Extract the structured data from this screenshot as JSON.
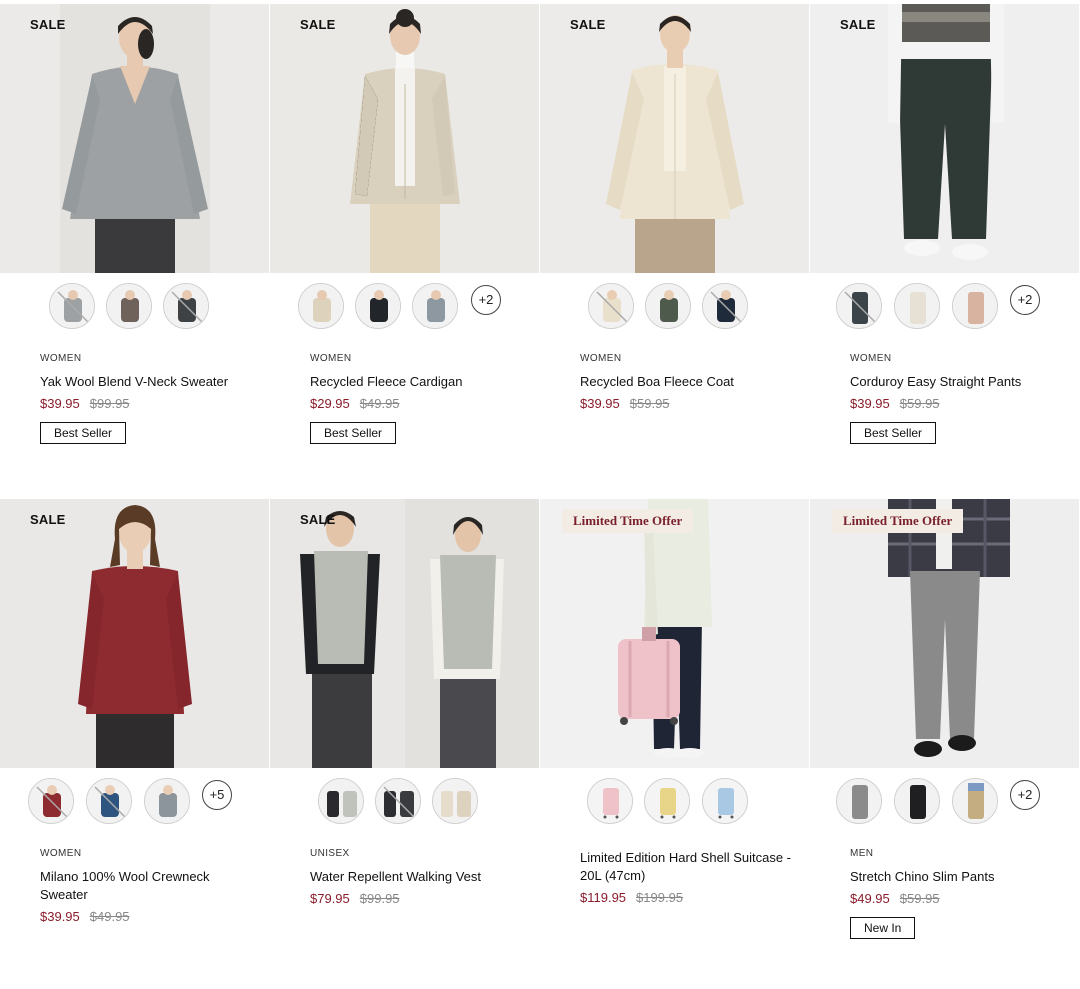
{
  "products": [
    {
      "tag": "SALE",
      "category": "WOMEN",
      "name": "Yak Wool Blend V-Neck Sweater",
      "price": "$39.95",
      "original_price": "$99.95",
      "badge": "Best Seller",
      "more_colors": "",
      "colors": {
        "bg": "#eceae8",
        "top": "#9da1a3",
        "bottom": "#3a3a3c",
        "skin": "#e6c9b0",
        "hair": "#2a2623"
      },
      "swatches": [
        "#9ea1a4",
        "#6e625a",
        "#3f4244"
      ]
    },
    {
      "tag": "SALE",
      "category": "WOMEN",
      "name": "Recycled Fleece Cardigan",
      "price": "$29.95",
      "original_price": "$49.95",
      "badge": "Best Seller",
      "more_colors": "+2",
      "colors": {
        "bg": "#ebe9e6",
        "top": "#d9d1bd",
        "bottom": "#e3d7c0",
        "skin": "#e6c9b0",
        "hair": "#2a2623"
      },
      "swatches": [
        "#ddd3bd",
        "#22252a",
        "#8e98a1"
      ]
    },
    {
      "tag": "SALE",
      "category": "WOMEN",
      "name": "Recycled Boa Fleece Coat",
      "price": "$39.95",
      "original_price": "$59.95",
      "badge": "",
      "more_colors": "",
      "colors": {
        "bg": "#ecebe9",
        "top": "#ede5d2",
        "bottom": "#b8a58c",
        "skin": "#e8cdb3",
        "hair": "#2c2420"
      },
      "swatches": [
        "#e9e0cc",
        "#4e5a4c",
        "#1f2a3a"
      ]
    },
    {
      "tag": "SALE",
      "category": "WOMEN",
      "name": "Corduroy Easy Straight Pants",
      "price": "$39.95",
      "original_price": "$59.95",
      "badge": "Best Seller",
      "more_colors": "+2",
      "colors": {
        "bg": "#efefef",
        "top": "#f4f4f4",
        "bottom": "#2f3a36",
        "skin": "#e8cdb3",
        "hair": "#333"
      },
      "swatches": [
        "#3b4448",
        "#e6e1d4",
        "#d8b4a0"
      ]
    },
    {
      "tag": "SALE",
      "category": "WOMEN",
      "name": "Milano 100% Wool Crewneck Sweater",
      "price": "$39.95",
      "original_price": "$49.95",
      "badge": "",
      "more_colors": "+5",
      "colors": {
        "bg": "#eae8e6",
        "top": "#8e2b30",
        "bottom": "#2e2c2c",
        "skin": "#e9cdb5",
        "hair": "#5a3b26"
      },
      "swatches": [
        "#8e2b30",
        "#2d5580",
        "#8c949c"
      ]
    },
    {
      "tag": "SALE",
      "category": "UNISEX",
      "name": "Water Repellent Walking Vest",
      "price": "$79.95",
      "original_price": "$99.95",
      "badge": "",
      "more_colors": "",
      "colors": {
        "bg": "#e8e7e5",
        "top": "#b9bcb4",
        "bottom": "#3c3c3e",
        "skin": "#e3c4a8",
        "hair": "#2a2623"
      },
      "swatches": [
        "#c0c3bb",
        "#2c2d30",
        "#e6dccb"
      ]
    },
    {
      "tag": "Limited Time Offer",
      "category": "",
      "name": "Limited Edition Hard Shell Suitcase - 20L (47cm)",
      "price": "$119.95",
      "original_price": "$199.95",
      "badge": "",
      "more_colors": "",
      "colors": {
        "bg": "#f1f1f1",
        "top": "#e9ece0",
        "bottom": "#1f2535",
        "skin": "#e8cdb3",
        "hair": "#333",
        "case": "#efc1c9"
      },
      "swatches": [
        "#efc1c9",
        "#e9d58a",
        "#a9c8e4"
      ]
    },
    {
      "tag": "Limited Time Offer",
      "category": "MEN",
      "name": "Stretch Chino Slim Pants",
      "price": "$49.95",
      "original_price": "$59.95",
      "badge": "New In",
      "more_colors": "+2",
      "colors": {
        "bg": "#eeeeee",
        "top": "#3b3b45",
        "bottom": "#8a8a8a",
        "skin": "#e8cdb3",
        "hair": "#333"
      },
      "swatches": [
        "#8b8b8b",
        "#1f1f22",
        "#c4ad80"
      ]
    }
  ]
}
